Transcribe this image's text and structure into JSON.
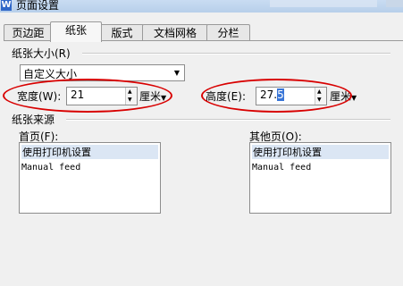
{
  "window": {
    "title": "页面设置"
  },
  "tabs": [
    {
      "label": "页边距",
      "active": false
    },
    {
      "label": "纸张",
      "active": true
    },
    {
      "label": "版式",
      "active": false
    },
    {
      "label": "文档网格",
      "active": false
    },
    {
      "label": "分栏",
      "active": false
    }
  ],
  "paper_size": {
    "section_label": "纸张大小(R)",
    "selected": "自定义大小",
    "width_label": "宽度(W):",
    "width_value": "21",
    "width_unit": "厘米",
    "height_label": "高度(E):",
    "height_value_main": "27.",
    "height_value_selected": "5",
    "height_unit": "厘米"
  },
  "paper_source": {
    "section_label": "纸张来源",
    "first_page_label": "首页(F):",
    "other_pages_label": "其他页(O):",
    "first_page_options": [
      "使用打印机设置",
      "Manual feed"
    ],
    "other_pages_options": [
      "使用打印机设置",
      "Manual feed"
    ]
  },
  "colors": {
    "highlight_ellipse": "#d80000",
    "selection": "#3875d7"
  },
  "icons": {
    "dropdown": "chevron-down-icon",
    "spin": "spin-arrows-icon"
  }
}
